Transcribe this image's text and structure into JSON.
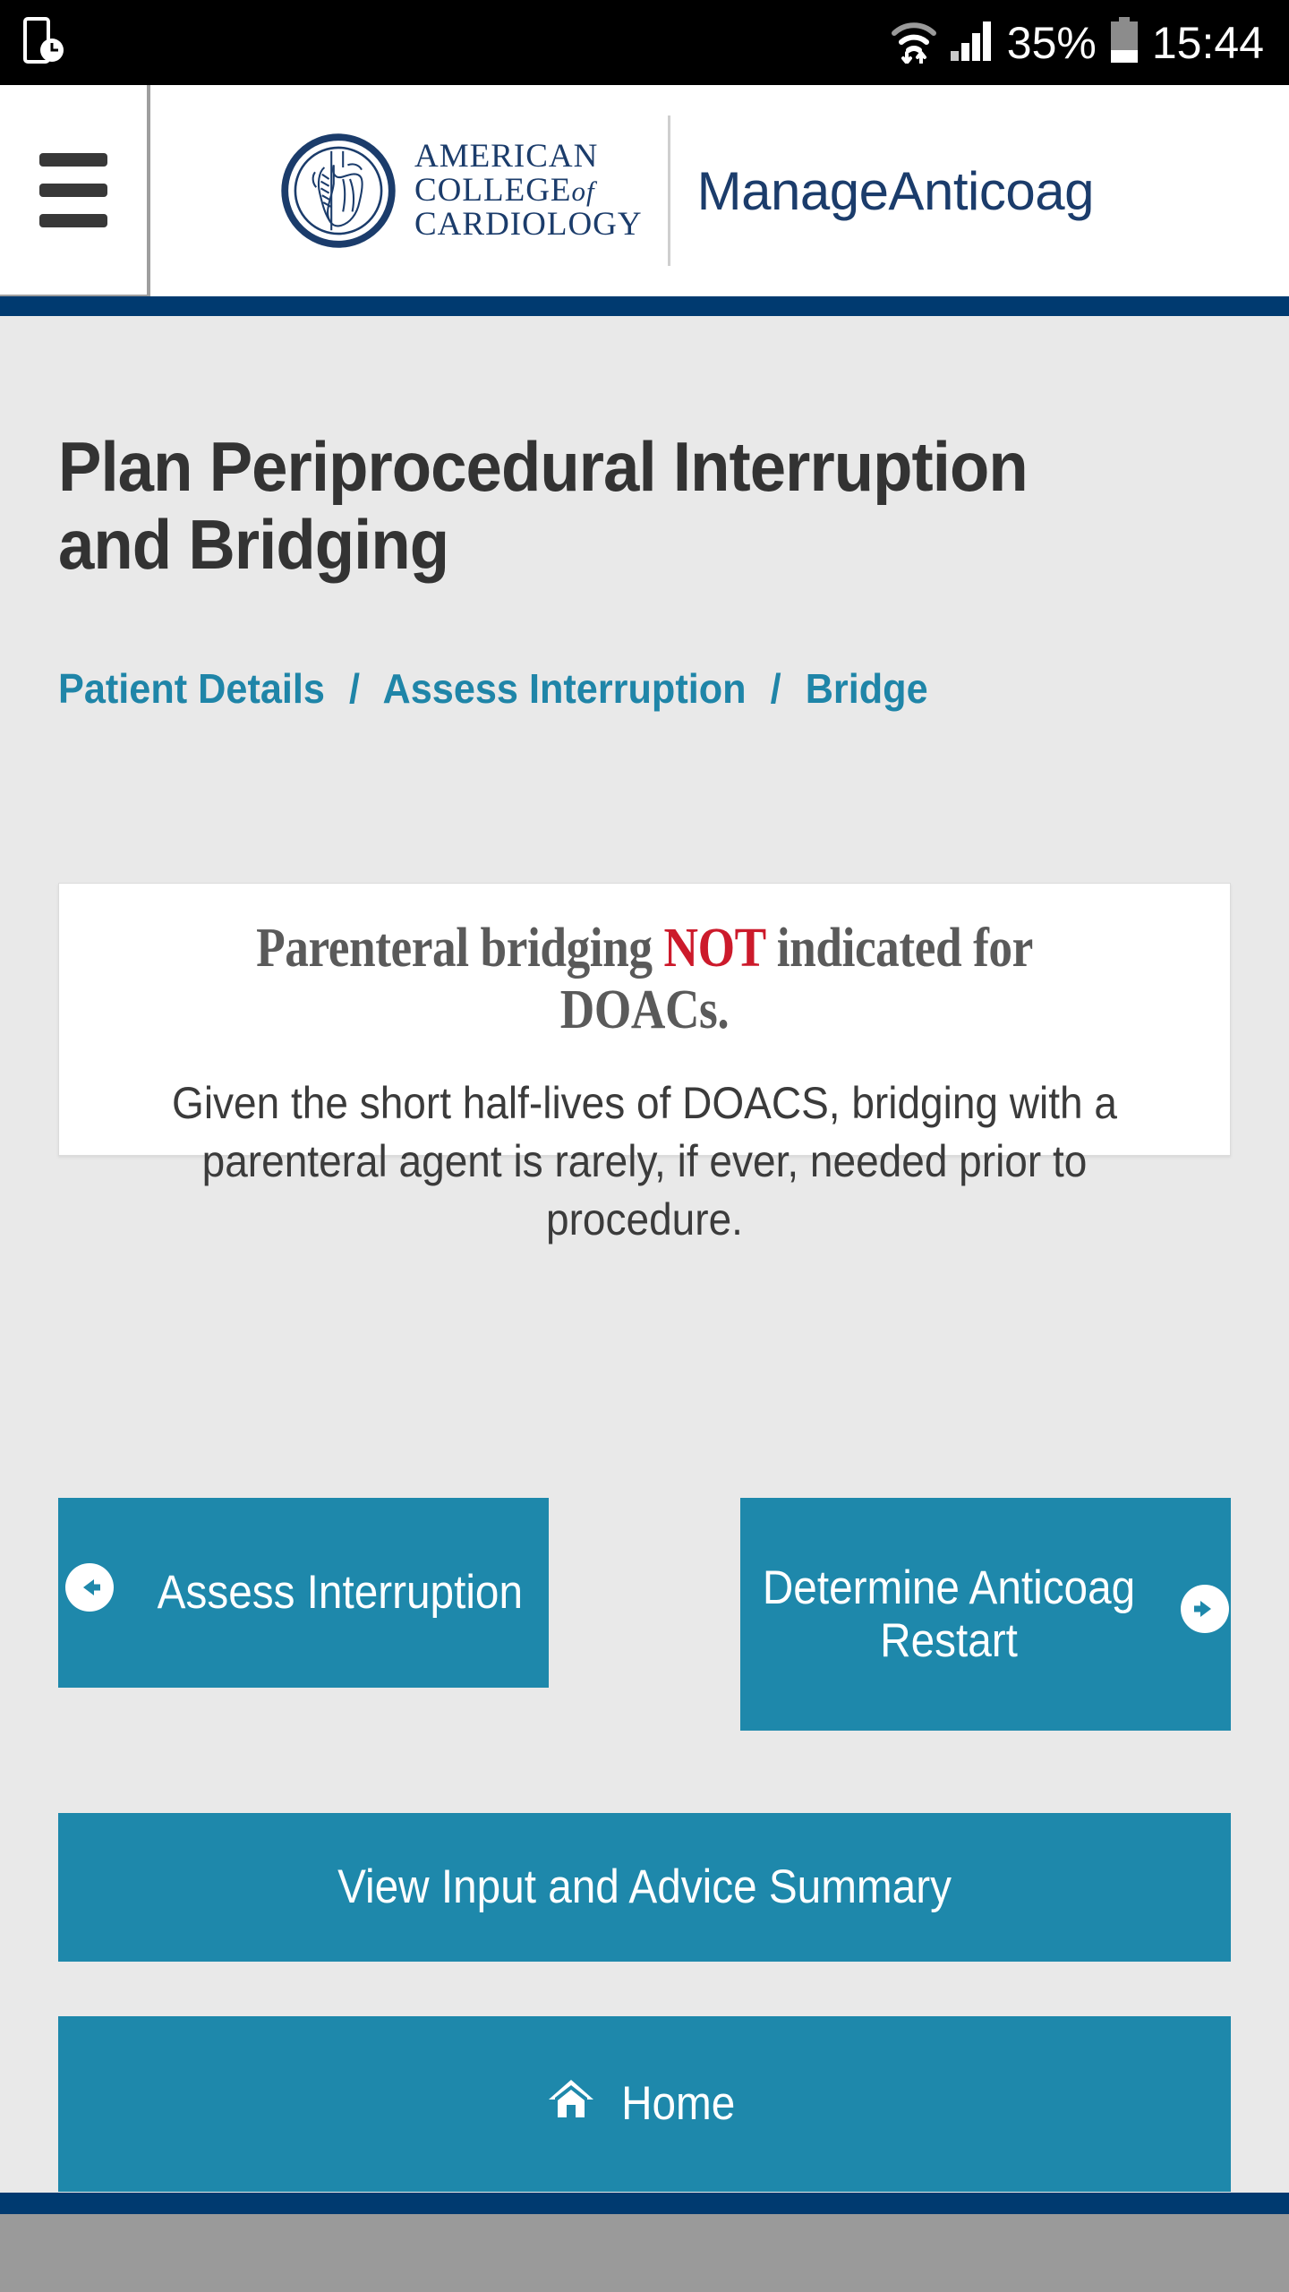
{
  "statusbar": {
    "left_icon": "screen-record-icon",
    "wifi_icon": "wifi-transfer-icon",
    "signal_icon": "cell-signal-icon",
    "battery_percent": "35%",
    "battery_icon": "battery-icon",
    "time": "15:44"
  },
  "header": {
    "menu_icon": "hamburger-menu-icon",
    "logo_icon": "acc-heart-seal-icon",
    "logo_line1": "AMERICAN",
    "logo_line2a": "COLLEGE",
    "logo_line2b": "of",
    "logo_line3": "CARDIOLOGY",
    "app_name": "ManageAnticoag"
  },
  "main": {
    "title": "Plan Periprocedural Interruption and Bridging",
    "breadcrumb": {
      "items": [
        "Patient Details",
        "Assess Interruption",
        "Bridge"
      ],
      "separator": "/"
    },
    "card": {
      "heading_before": "Parenteral bridging ",
      "heading_emphasis": "NOT",
      "heading_after": " indicated for DOACs.",
      "body": "Given the short half-lives of DOACS, bridging with a parenteral agent is rarely, if ever, needed prior to procedure."
    },
    "buttons": {
      "back": {
        "label": "Assess Interruption",
        "icon": "arrow-circle-left-icon"
      },
      "next": {
        "label": "Determine Anticoag Restart",
        "icon": "arrow-circle-right-icon"
      },
      "summary": {
        "label": "View Input and Advice Summary"
      },
      "home": {
        "label": "Home",
        "icon": "home-icon"
      }
    }
  },
  "colors": {
    "brand_navy": "#003a70",
    "accent_teal": "#1e88ab",
    "alert_red": "#cc1a2b",
    "page_bg": "#e9e9e9"
  }
}
